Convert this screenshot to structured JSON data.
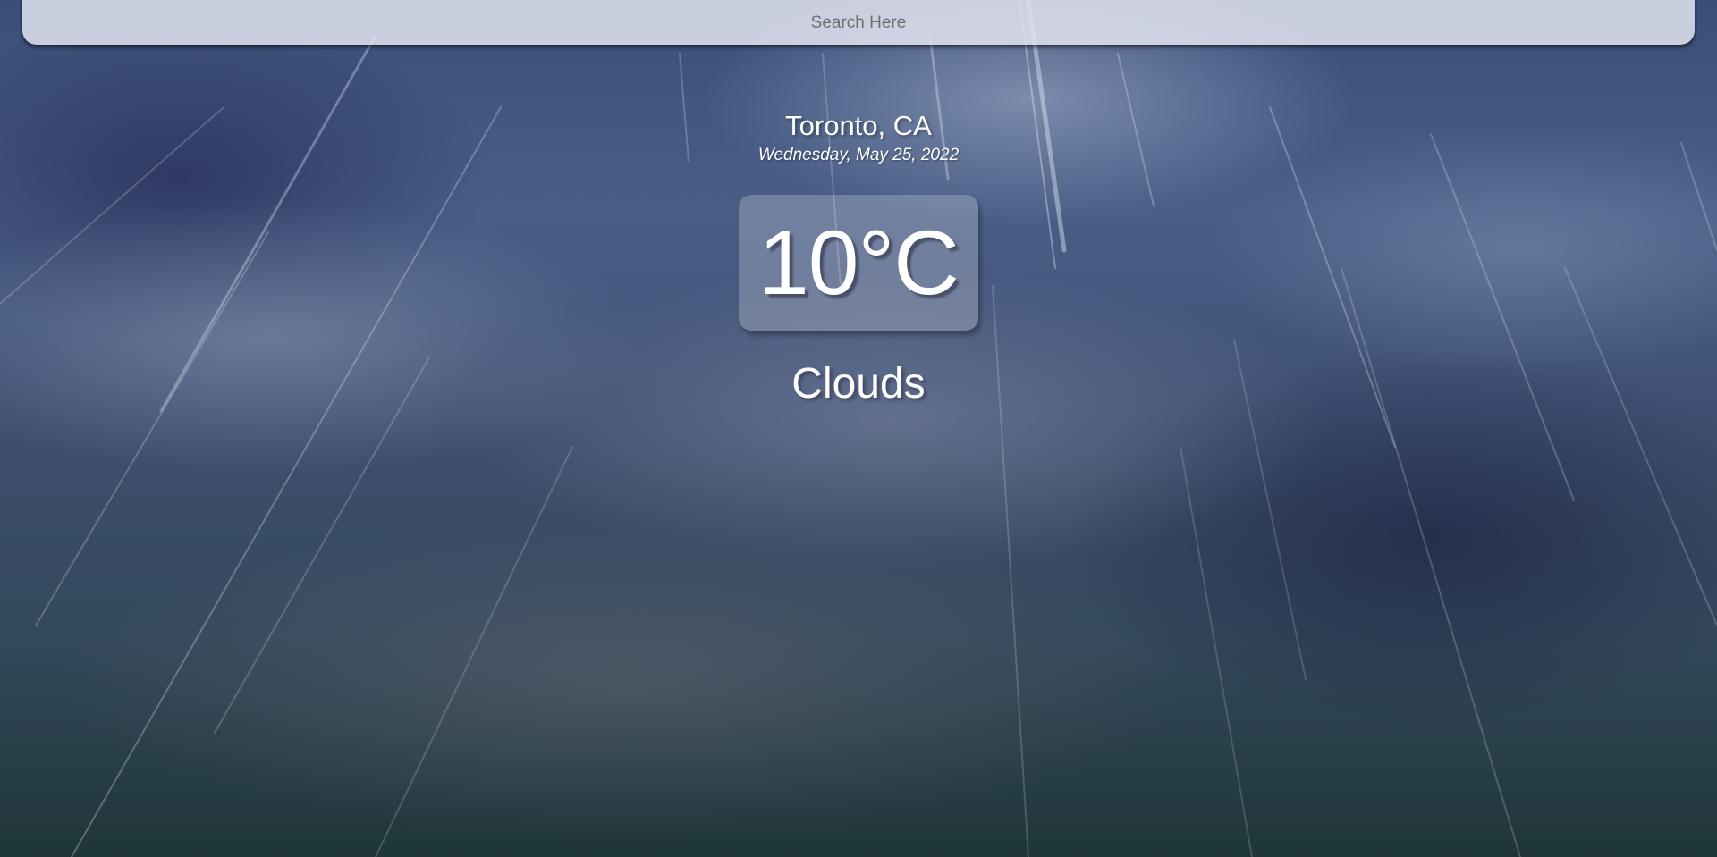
{
  "search": {
    "placeholder": "Search Here",
    "value": ""
  },
  "weather": {
    "location": "Toronto, CA",
    "date": "Wednesday, May 25, 2022",
    "temperature": "10°C",
    "condition": "Clouds"
  },
  "colors": {
    "text": "#ffffff",
    "search_bg": "#e2e4f0",
    "search_placeholder": "#707070"
  }
}
